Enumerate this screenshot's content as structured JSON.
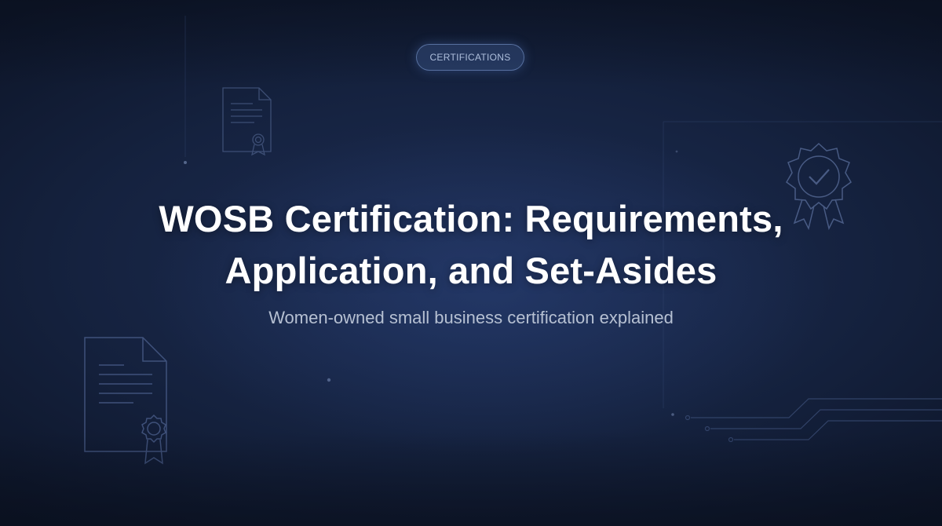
{
  "badge": {
    "label": "CERTIFICATIONS"
  },
  "hero": {
    "title_line1": "WOSB Certification: Requirements,",
    "title_line2": "Application, and Set-Asides",
    "subtitle": "Women-owned small business certification explained"
  },
  "colors": {
    "background_dark": "#0d1528",
    "background_mid": "#1d2d54",
    "title": "#ffffff",
    "subtitle": "#b6c0d2",
    "badge_text": "#aebfdc",
    "icon_stroke": "#5a6f98"
  },
  "decorations": {
    "icons": [
      "certificate-document-icon",
      "certificate-document-icon",
      "award-seal-checkmark-icon",
      "circuit-lines-icon"
    ]
  }
}
